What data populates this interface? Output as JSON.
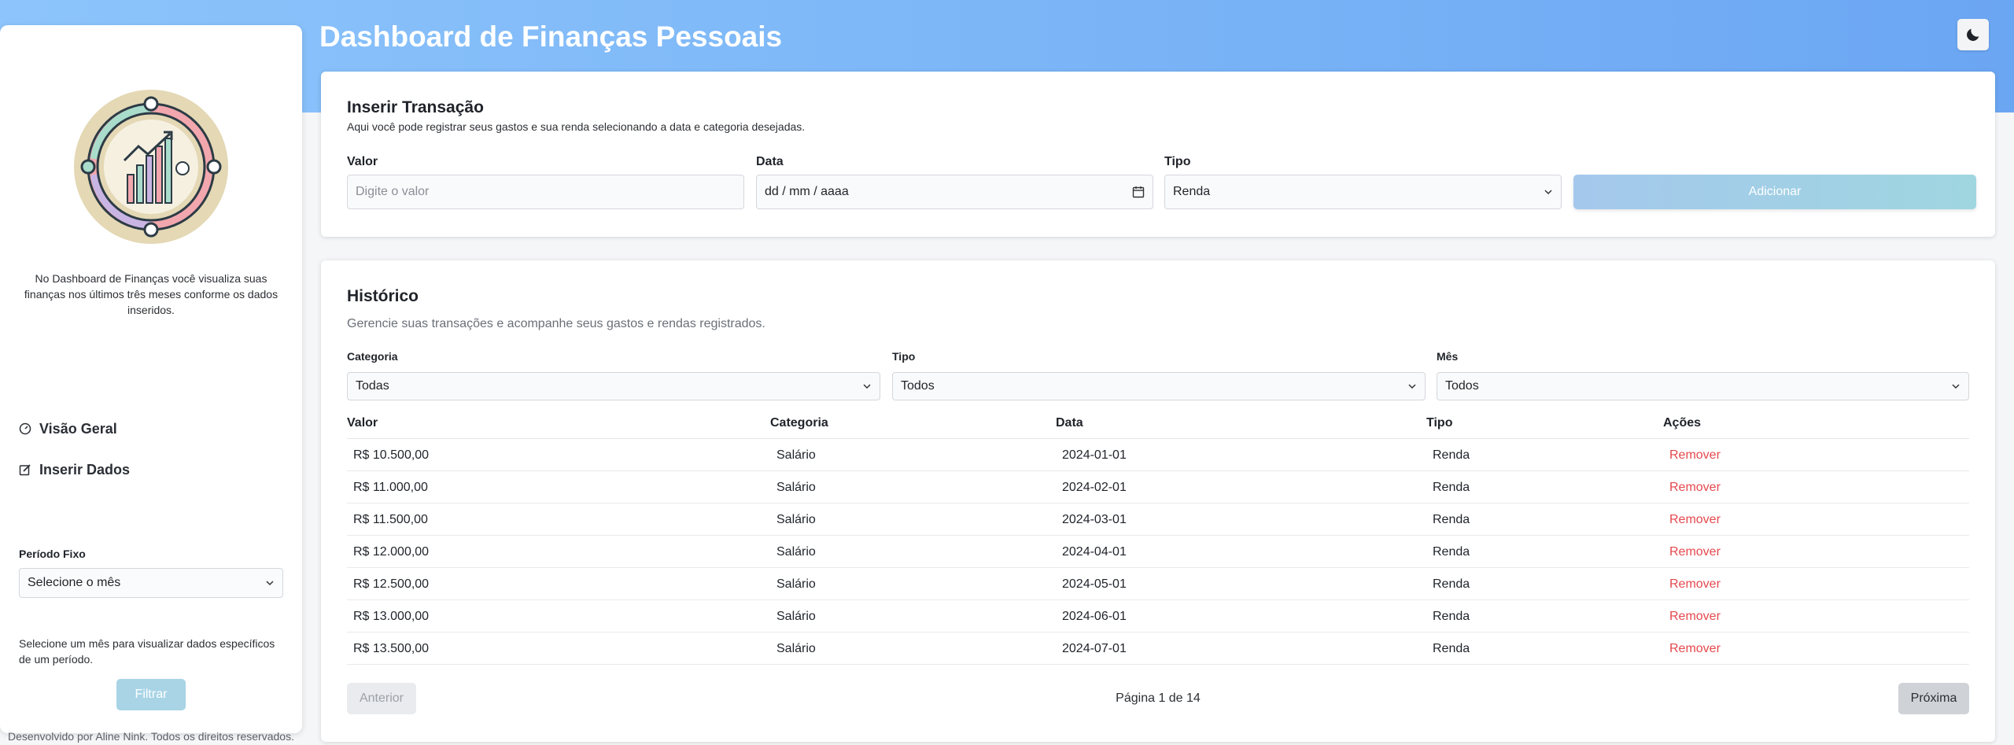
{
  "header": {
    "title": "Dashboard de Finanças Pessoais",
    "theme_icon": "moon-icon"
  },
  "sidebar": {
    "description": "No Dashboard de Finanças você visualiza suas finanças nos últimos três meses conforme os dados inseridos.",
    "nav": [
      {
        "label": "Visão Geral",
        "icon": "gauge-icon"
      },
      {
        "label": "Inserir Dados",
        "icon": "edit-icon"
      }
    ],
    "period_label": "Período Fixo",
    "period_select": "Selecione o mês",
    "period_help": "Selecione um mês para visualizar dados específicos de um período.",
    "filter_button": "Filtrar",
    "footer": "Desenvolvido por Aline Nink. Todos os direitos reservados."
  },
  "insert": {
    "title": "Inserir Transação",
    "subtitle": "Aqui você pode registrar seus gastos e sua renda selecionando a data e categoria desejadas.",
    "valor_label": "Valor",
    "valor_placeholder": "Digite o valor",
    "data_label": "Data",
    "data_placeholder": "dd / mm / aaaa",
    "tipo_label": "Tipo",
    "tipo_value": "Renda",
    "add_button": "Adicionar"
  },
  "history": {
    "title": "Histórico",
    "subtitle": "Gerencie suas transações e acompanhe seus gastos e rendas registrados.",
    "filters": {
      "categoria_label": "Categoria",
      "categoria_value": "Todas",
      "tipo_label": "Tipo",
      "tipo_value": "Todos",
      "mes_label": "Mês",
      "mes_value": "Todos"
    },
    "columns": [
      "Valor",
      "Categoria",
      "Data",
      "Tipo",
      "Ações"
    ],
    "rows": [
      {
        "valor": "R$ 10.500,00",
        "categoria": "Salário",
        "data": "2024-01-01",
        "tipo": "Renda",
        "acao": "Remover"
      },
      {
        "valor": "R$ 11.000,00",
        "categoria": "Salário",
        "data": "2024-02-01",
        "tipo": "Renda",
        "acao": "Remover"
      },
      {
        "valor": "R$ 11.500,00",
        "categoria": "Salário",
        "data": "2024-03-01",
        "tipo": "Renda",
        "acao": "Remover"
      },
      {
        "valor": "R$ 12.000,00",
        "categoria": "Salário",
        "data": "2024-04-01",
        "tipo": "Renda",
        "acao": "Remover"
      },
      {
        "valor": "R$ 12.500,00",
        "categoria": "Salário",
        "data": "2024-05-01",
        "tipo": "Renda",
        "acao": "Remover"
      },
      {
        "valor": "R$ 13.000,00",
        "categoria": "Salário",
        "data": "2024-06-01",
        "tipo": "Renda",
        "acao": "Remover"
      },
      {
        "valor": "R$ 13.500,00",
        "categoria": "Salário",
        "data": "2024-07-01",
        "tipo": "Renda",
        "acao": "Remover"
      }
    ],
    "prev_button": "Anterior",
    "page_info": "Página 1 de 14",
    "next_button": "Próxima"
  },
  "colors": {
    "accent": "#7cb6f7",
    "danger": "#e5484d",
    "button_disabled": "#a8d4e6"
  }
}
